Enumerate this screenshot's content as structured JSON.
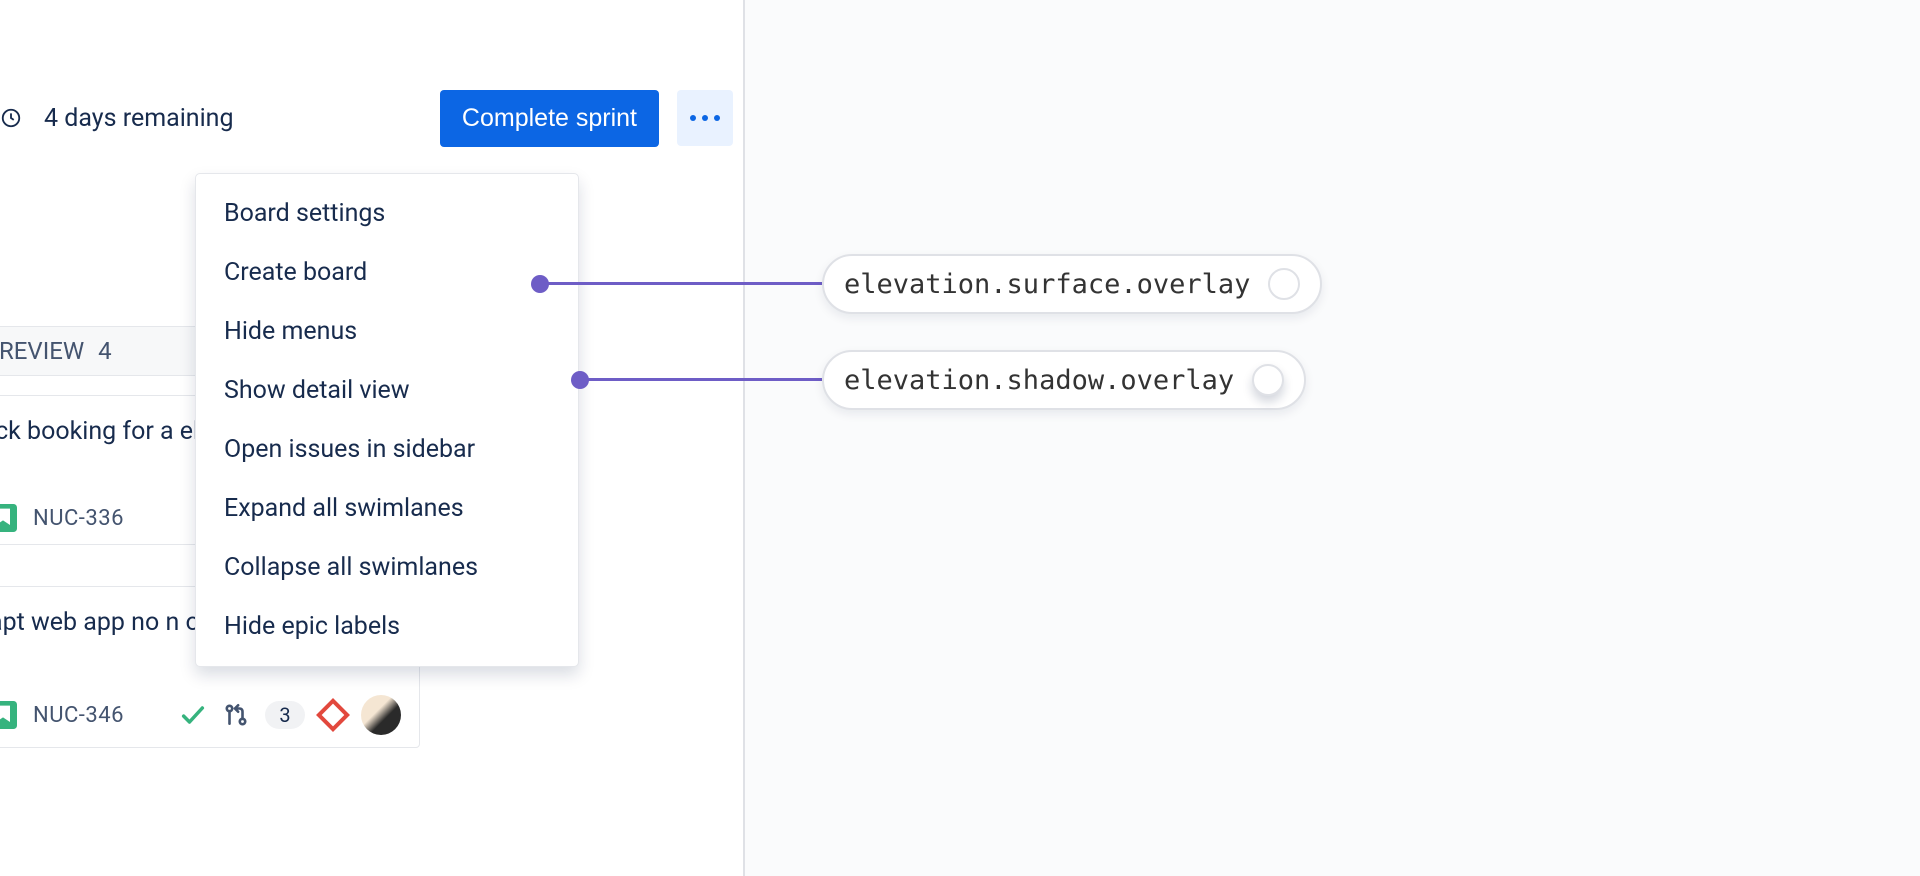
{
  "topbar": {
    "remaining": "4 days remaining",
    "complete_label": "Complete sprint"
  },
  "menu": {
    "items": [
      "Board settings",
      "Create board",
      "Hide menus",
      "Show detail view",
      "Open issues in sidebar",
      "Expand all swimlanes",
      "Collapse all swimlanes",
      "Hide epic labels"
    ]
  },
  "column": {
    "name": "REVIEW",
    "count": "4"
  },
  "cards": [
    {
      "title": "ick booking for a eb",
      "key": "NUC-336"
    },
    {
      "title": "apt web app no n ovider",
      "key": "NUC-346",
      "points": "3"
    }
  ],
  "annotations": {
    "surface": "elevation.surface.overlay",
    "shadow": "elevation.shadow.overlay"
  }
}
